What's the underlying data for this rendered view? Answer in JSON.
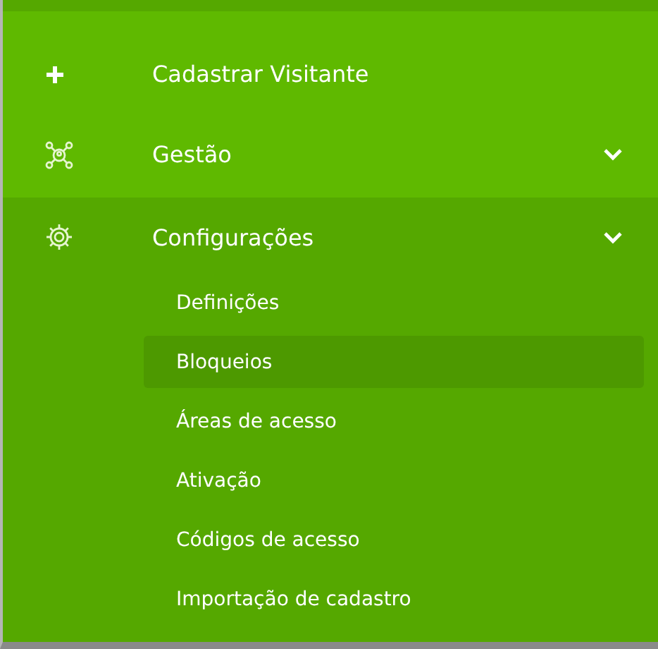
{
  "menu": [
    {
      "label": "Cadastrar Visitante",
      "kind": "action",
      "expanded": false
    },
    {
      "label": "Gestão",
      "kind": "submenu",
      "expanded": false
    },
    {
      "label": "Configurações",
      "kind": "submenu",
      "expanded": true,
      "children": [
        {
          "label": "Definições",
          "selected": false
        },
        {
          "label": "Bloqueios",
          "selected": true
        },
        {
          "label": "Áreas de acesso",
          "selected": false
        },
        {
          "label": "Ativação",
          "selected": false
        },
        {
          "label": "Códigos de acesso",
          "selected": false
        },
        {
          "label": "Importação de cadastro",
          "selected": false
        }
      ]
    }
  ]
}
